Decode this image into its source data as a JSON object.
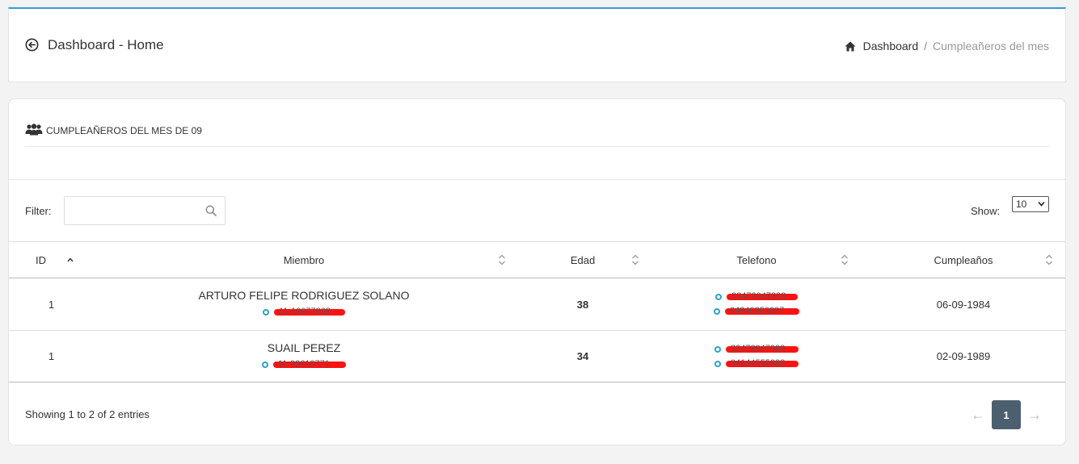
{
  "header": {
    "title": "Dashboard - Home",
    "breadcrumb": {
      "home": "Dashboard",
      "separator": "/",
      "current": "Cumpleañeros del mes"
    }
  },
  "section": {
    "title": "CUMPLEAÑEROS DEL MES DE 09"
  },
  "filter": {
    "label": "Filter:",
    "value": "",
    "placeholder": ""
  },
  "show": {
    "label": "Show:",
    "selected": "10"
  },
  "table": {
    "columns": [
      "ID",
      "Miembro",
      "Edad",
      "Telefono",
      "Cumpleaños"
    ],
    "rows": [
      {
        "id": "1",
        "name": "ARTURO FELIPE RODRIGUEZ SOLANO",
        "doc": "11-10077808",
        "age": "38",
        "phone1": "22473047333",
        "phone2": "04840850007",
        "birthday": "06-09-1984"
      },
      {
        "id": "1",
        "name": "SUAIL PEREZ",
        "doc": "11-99619771",
        "age": "34",
        "phone1": "22478047988",
        "phone2": "04144555988",
        "birthday": "02-09-1989"
      }
    ]
  },
  "footer": {
    "info": "Showing 1 to 2 of 2 entries",
    "pagination": {
      "prev": "←",
      "page": "1",
      "next": "→"
    }
  },
  "colors": {
    "accent": "#3a9ad9",
    "dot": "#29a3c9",
    "redaction": "#ff1111",
    "pager_active": "#4b5f6f"
  }
}
